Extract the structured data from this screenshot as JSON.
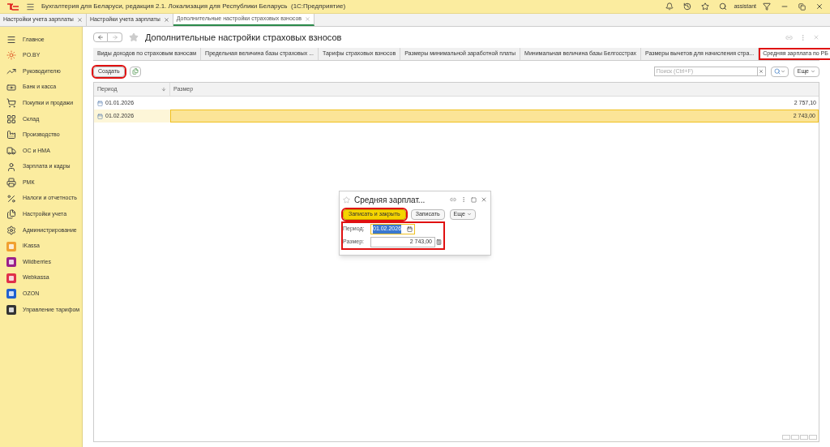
{
  "app_bar": {
    "title": "Бухгалтерия для Беларуси, редакция 2.1. Локализация для Республики Беларусь  (1С:Предприятие)",
    "user": "assistant"
  },
  "open_tabs": [
    {
      "label": "Настройки учета зарплаты",
      "selected": false
    },
    {
      "label": "Настройки учета зарплаты",
      "selected": false
    },
    {
      "label": "Дополнительные настройки страховых взносов",
      "selected": true
    }
  ],
  "sidebar": {
    "items": [
      {
        "label": "Главное"
      },
      {
        "label": "PO.BY"
      },
      {
        "label": "Руководителю"
      },
      {
        "label": "Банк и касса"
      },
      {
        "label": "Покупки и продажи"
      },
      {
        "label": "Склад"
      },
      {
        "label": "Производство"
      },
      {
        "label": "ОС и НМА"
      },
      {
        "label": "Зарплата и кадры"
      },
      {
        "label": "РМК"
      },
      {
        "label": "Налоги и отчетность"
      },
      {
        "label": "Настройки учета"
      },
      {
        "label": "Администрирование"
      },
      {
        "label": "iKassa"
      },
      {
        "label": "Wildberries"
      },
      {
        "label": "Webkassa"
      },
      {
        "label": "OZON"
      },
      {
        "label": "Управление тарифом"
      }
    ]
  },
  "form": {
    "title": "Дополнительные настройки страховых взносов",
    "tabs": [
      {
        "label": "Виды доходов по страховым взносам",
        "selected": false,
        "highlighted": false
      },
      {
        "label": "Предельная величина базы страховых ...",
        "selected": false,
        "highlighted": false
      },
      {
        "label": "Тарифы страховых взносов",
        "selected": false,
        "highlighted": false
      },
      {
        "label": "Размеры минимальной заработной платы",
        "selected": false,
        "highlighted": false
      },
      {
        "label": "Минимальная величина базы Белгосстрах",
        "selected": false,
        "highlighted": false
      },
      {
        "label": "Размеры вычетов для начисления стра...",
        "selected": false,
        "highlighted": false
      },
      {
        "label": "Средняя зарплата по РБ",
        "selected": true,
        "highlighted": true
      }
    ],
    "create_button": {
      "label": "Создать",
      "highlighted": true
    },
    "search": {
      "placeholder": "Поиск (Ctrl+F)"
    },
    "more_button": "Еще",
    "table": {
      "columns": [
        "Период",
        "Размер"
      ],
      "rows": [
        {
          "period": "01.01.2026",
          "size": "2 757,10",
          "selected": false
        },
        {
          "period": "01.02.2026",
          "size": "2 743,00",
          "selected": true
        }
      ]
    }
  },
  "dialog": {
    "title": "Средняя зарплат...",
    "save_close": {
      "label": "Записать и закрыть",
      "highlighted": true
    },
    "save": "Записать",
    "more": "Еще",
    "fields_highlighted": true,
    "fields": [
      {
        "label": "Период:",
        "value": "01.02.2026",
        "kind": "date"
      },
      {
        "label": "Размер:",
        "value": "2 743,00",
        "kind": "number"
      }
    ]
  }
}
